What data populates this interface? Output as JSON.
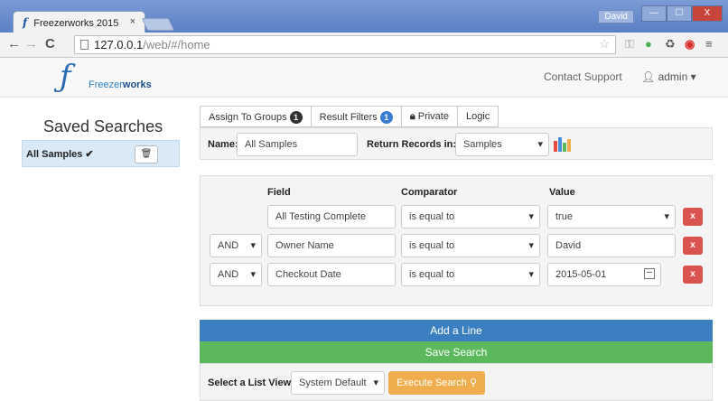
{
  "browser": {
    "tab_title": "Freezerworks 2015",
    "tab_close": "×",
    "window_user": "David",
    "url_host": "127.0.0.1",
    "url_path": "/web/#/home"
  },
  "header": {
    "logo_text_a": "Freezer",
    "logo_text_b": "works",
    "contact_support": "Contact Support",
    "user_menu": "admin"
  },
  "sidebar": {
    "title": "Saved Searches",
    "items": [
      {
        "label": "All Samples ✔"
      }
    ]
  },
  "tabs": [
    {
      "label": "Assign To Groups",
      "badge": "1"
    },
    {
      "label": "Result Filters",
      "badge": "1"
    },
    {
      "label": "Private"
    },
    {
      "label": "Logic"
    }
  ],
  "search": {
    "name_label": "Name:",
    "name_value": "All Samples",
    "return_label": "Return Records in:",
    "return_value": "Samples"
  },
  "filters": {
    "headers": {
      "field": "Field",
      "comparator": "Comparator",
      "value": "Value"
    },
    "rows": [
      {
        "logic": "",
        "field": "All Testing Complete",
        "comparator": "is equal to",
        "value": "true",
        "remove": "x"
      },
      {
        "logic": "AND",
        "field": "Owner Name",
        "comparator": "is equal to",
        "value": "David",
        "remove": "x"
      },
      {
        "logic": "AND",
        "field": "Checkout Date",
        "comparator": "is equal to",
        "value": "2015-05-01",
        "remove": "x"
      }
    ]
  },
  "actions": {
    "add_line": "Add a Line",
    "save_search": "Save Search",
    "list_view_label": "Select a List View:",
    "list_view_value": "System Default",
    "execute": "Execute Search"
  },
  "colors": {
    "primary": "#3c7fc1",
    "success": "#5cb85c",
    "warning": "#f0ad4e",
    "danger": "#d9534f",
    "selected_row": "#d9e9f6"
  }
}
